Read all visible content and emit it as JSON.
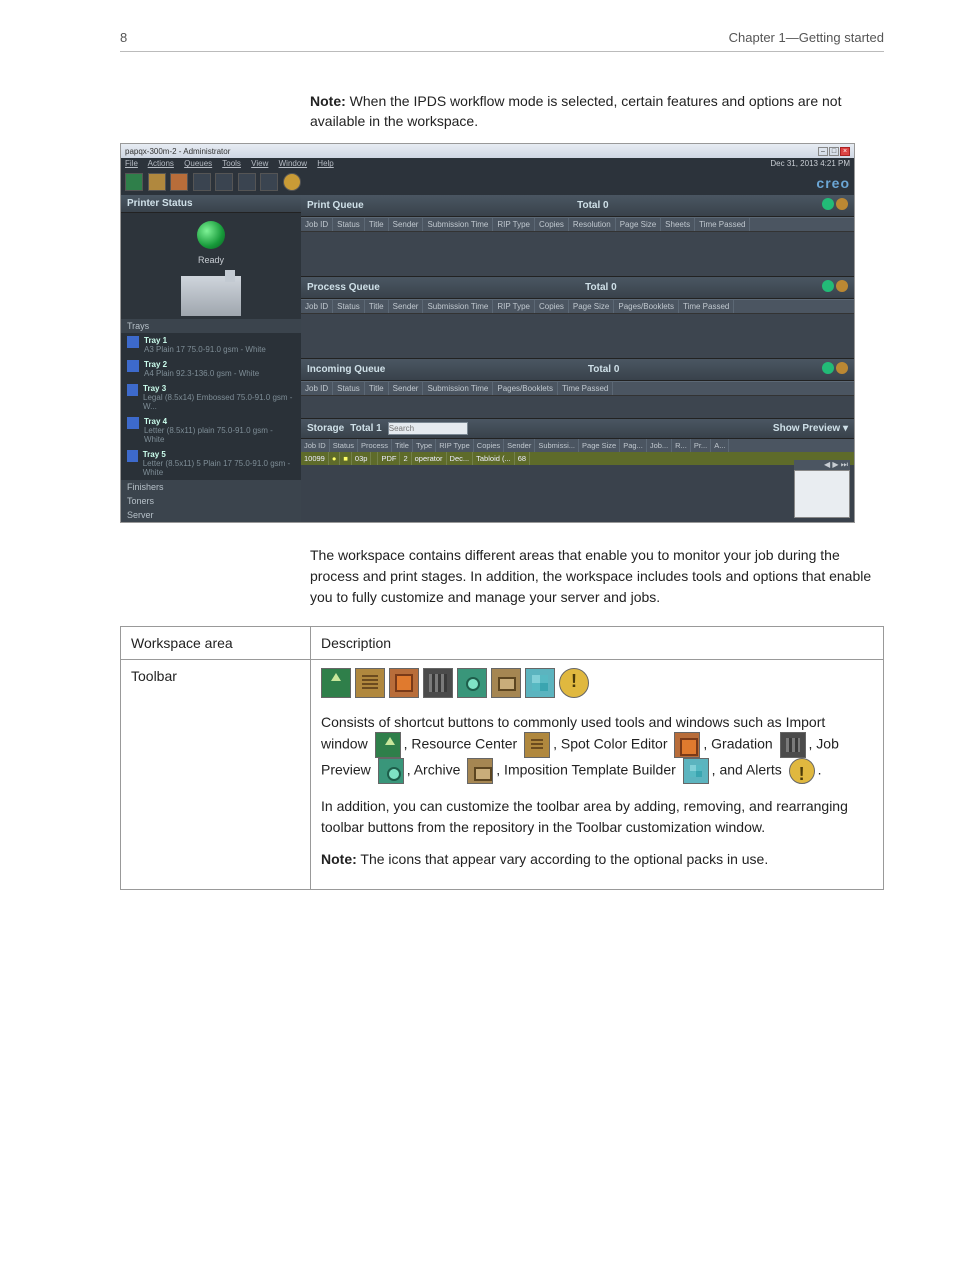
{
  "page": {
    "number": "8",
    "chapter": "Chapter 1—Getting started"
  },
  "note": {
    "label": "Note:",
    "text": "When the IPDS workflow mode is selected, certain features and options are not available in the workspace."
  },
  "screenshot": {
    "title": "papqx-300m-2 - Administrator",
    "date": "Dec 31, 2013 4:21 PM",
    "logo": "creo",
    "menus": [
      "File",
      "Actions",
      "Queues",
      "Tools",
      "View",
      "Window",
      "Help"
    ],
    "printer_status": {
      "label": "Printer Status",
      "state": "Ready"
    },
    "trays": {
      "header": "Trays",
      "items": [
        {
          "name": "Tray 1",
          "spec": "A3 Plain 17 75.0-91.0 gsm - White"
        },
        {
          "name": "Tray 2",
          "spec": "A4 Plain 92.3-136.0 gsm - White"
        },
        {
          "name": "Tray 3",
          "spec": "Legal (8.5x14) Embossed 75.0-91.0 gsm - W..."
        },
        {
          "name": "Tray 4",
          "spec": "Letter (8.5x11) plain 75.0-91.0 gsm - White"
        },
        {
          "name": "Tray 5",
          "spec": "Letter (8.5x11) 5 Plain 17 75.0-91.0 gsm - White"
        }
      ]
    },
    "side_sections": [
      "Finishers",
      "Toners",
      "Server"
    ],
    "print_queue": {
      "title": "Print Queue",
      "total_label": "Total",
      "total": "0",
      "cols": [
        "Job ID",
        "Status",
        "Title",
        "Sender",
        "Submission Time",
        "RIP Type",
        "Copies",
        "Resolution",
        "Page Size",
        "Sheets",
        "Time Passed"
      ]
    },
    "process_queue": {
      "title": "Process Queue",
      "total_label": "Total",
      "total": "0",
      "cols": [
        "Job ID",
        "Status",
        "Title",
        "Sender",
        "Submission Time",
        "RIP Type",
        "Copies",
        "Page Size",
        "Pages/Booklets",
        "Time Passed"
      ]
    },
    "incoming_queue": {
      "title": "Incoming Queue",
      "total_label": "Total",
      "total": "0",
      "cols": [
        "Job ID",
        "Status",
        "Title",
        "Sender",
        "Submission Time",
        "Pages/Booklets",
        "Time Passed"
      ]
    },
    "storage": {
      "title": "Storage",
      "total_label": "Total",
      "total": "1",
      "search_placeholder": "Search",
      "show_label": "Show",
      "preview_label": "Preview",
      "cols": [
        "Job ID",
        "Status",
        "Process",
        "Title",
        "Type",
        "RIP Type",
        "Copies",
        "Sender",
        "Submissi...",
        "Page Size",
        "Pag...",
        "Job...",
        "R...",
        "Pr...",
        "A..."
      ],
      "row": {
        "job_id": "10099",
        "status_dot": "●",
        "process_dot": "■",
        "title": "03p",
        "type": "",
        "rip": "PDF",
        "copies": "2",
        "sender": "operator",
        "submitted": "Dec...",
        "page_size": "Tabloid (...",
        "pages": "68"
      }
    }
  },
  "body_paragraph": "The workspace contains different areas that enable you to monitor your job during the process and print stages. In addition, the workspace includes tools and options that enable you to fully customize and manage your server and jobs.",
  "table": {
    "headers": [
      "Workspace area",
      "Description"
    ],
    "row1": {
      "area": "Toolbar",
      "p1_a": "Consists of shortcut buttons to commonly used tools and windows such as Import window ",
      "p1_b": ", Resource Center ",
      "p1_c": ", Spot Color Editor ",
      "p1_d": ", Gradation ",
      "p1_e": ", Job Preview ",
      "p1_f": ", Archive ",
      "p1_g": ", Imposition Template Builder ",
      "p1_h": ", and Alerts ",
      "p1_i": ".",
      "p2": "In addition, you can customize the toolbar area by adding, removing, and rearranging toolbar buttons from the repository in the Toolbar customization window.",
      "p3_label": "Note:",
      "p3_text": "The icons that appear vary according to the optional packs in use."
    }
  }
}
